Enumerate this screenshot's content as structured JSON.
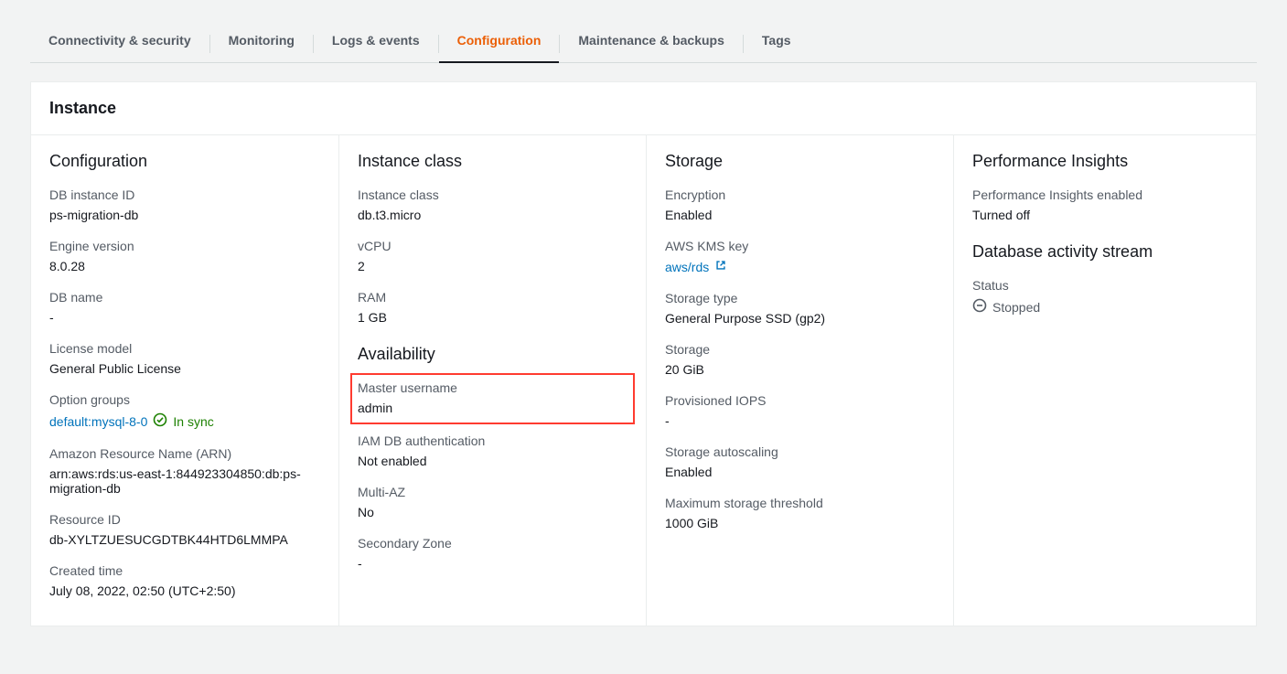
{
  "tabs": {
    "connectivity": "Connectivity & security",
    "monitoring": "Monitoring",
    "logs": "Logs & events",
    "configuration": "Configuration",
    "maintenance": "Maintenance & backups",
    "tags": "Tags"
  },
  "panel": {
    "title": "Instance"
  },
  "configuration": {
    "heading": "Configuration",
    "db_instance_id_label": "DB instance ID",
    "db_instance_id": "ps-migration-db",
    "engine_version_label": "Engine version",
    "engine_version": "8.0.28",
    "db_name_label": "DB name",
    "db_name": "-",
    "license_model_label": "License model",
    "license_model": "General Public License",
    "option_groups_label": "Option groups",
    "option_groups_link": "default:mysql-8-0",
    "option_groups_status": "In sync",
    "arn_label": "Amazon Resource Name (ARN)",
    "arn": "arn:aws:rds:us-east-1:844923304850:db:ps-migration-db",
    "resource_id_label": "Resource ID",
    "resource_id": "db-XYLTZUESUCGDTBK44HTD6LMMPA",
    "created_label": "Created time",
    "created": "July 08, 2022, 02:50 (UTC+2:50)"
  },
  "instance_class": {
    "heading": "Instance class",
    "instance_class_label": "Instance class",
    "instance_class": "db.t3.micro",
    "vcpu_label": "vCPU",
    "vcpu": "2",
    "ram_label": "RAM",
    "ram": "1 GB"
  },
  "availability": {
    "heading": "Availability",
    "master_username_label": "Master username",
    "master_username": "admin",
    "iam_label": "IAM DB authentication",
    "iam": "Not enabled",
    "multi_az_label": "Multi-AZ",
    "multi_az": "No",
    "secondary_zone_label": "Secondary Zone",
    "secondary_zone": "-"
  },
  "storage": {
    "heading": "Storage",
    "encryption_label": "Encryption",
    "encryption": "Enabled",
    "kms_label": "AWS KMS key",
    "kms_link": "aws/rds",
    "storage_type_label": "Storage type",
    "storage_type": "General Purpose SSD (gp2)",
    "storage_label": "Storage",
    "storage": "20 GiB",
    "iops_label": "Provisioned IOPS",
    "iops": "-",
    "autoscaling_label": "Storage autoscaling",
    "autoscaling": "Enabled",
    "max_threshold_label": "Maximum storage threshold",
    "max_threshold": "1000 GiB"
  },
  "performance": {
    "heading": "Performance Insights",
    "enabled_label": "Performance Insights enabled",
    "enabled": "Turned off"
  },
  "activity": {
    "heading": "Database activity stream",
    "status_label": "Status",
    "status": "Stopped"
  }
}
